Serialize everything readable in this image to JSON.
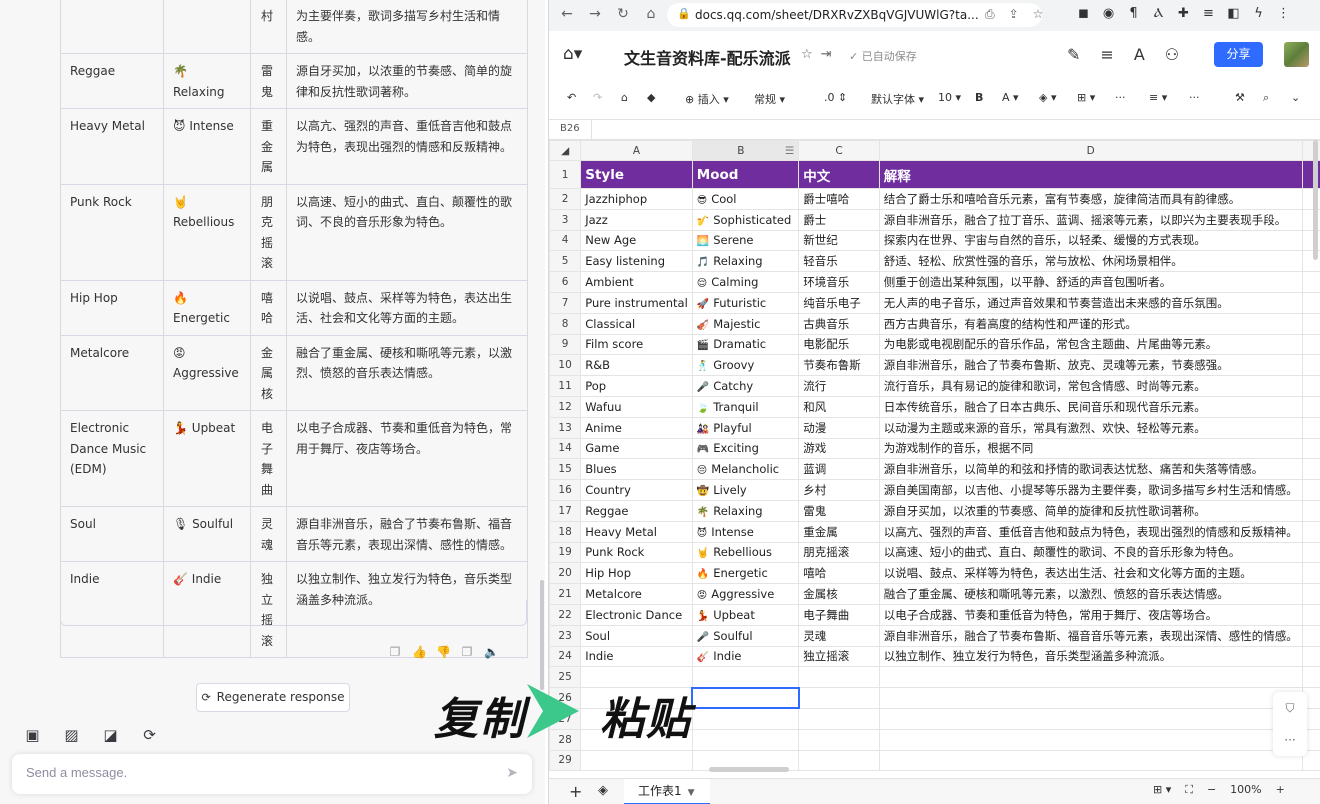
{
  "chat": {
    "rows": [
      {
        "style": "",
        "mood_emoji": "",
        "mood": "",
        "zh": "村",
        "desc": "为主要伴奏，歌词多描写乡村生活和情感。"
      },
      {
        "style": "Reggae",
        "mood_emoji": "🌴",
        "mood": "Relaxing",
        "zh": "雷鬼",
        "desc": "源自牙买加，以浓重的节奏感、简单的旋律和反抗性歌词著称。"
      },
      {
        "style": "Heavy Metal",
        "mood_emoji": "😈",
        "mood": "Intense",
        "zh": "重金属",
        "desc": "以高亢、强烈的声音、重低音吉他和鼓点为特色，表现出强烈的情感和反叛精神。"
      },
      {
        "style": "Punk Rock",
        "mood_emoji": "🤘",
        "mood": "Rebellious",
        "zh": "朋克摇滚",
        "desc": "以高速、短小的曲式、直白、颠覆性的歌词、不良的音乐形象为特色。"
      },
      {
        "style": "Hip Hop",
        "mood_emoji": "🔥",
        "mood": "Energetic",
        "zh": "嘻哈",
        "desc": "以说唱、鼓点、采样等为特色，表达出生活、社会和文化等方面的主题。"
      },
      {
        "style": "Metalcore",
        "mood_emoji": "😡",
        "mood": "Aggressive",
        "zh": "金属核",
        "desc": "融合了重金属、硬核和嘶吼等元素，以激烈、愤怒的音乐表达情感。"
      },
      {
        "style": "Electronic Dance Music (EDM)",
        "mood_emoji": "💃",
        "mood": "Upbeat",
        "zh": "电子舞曲",
        "desc": "以电子合成器、节奏和重低音为特色，常用于舞厅、夜店等场合。"
      },
      {
        "style": "Soul",
        "mood_emoji": "🎙",
        "mood": "Soulful",
        "zh": "灵魂",
        "desc": "源自非洲音乐，融合了节奏布鲁斯、福音音乐等元素，表现出深情、感性的情感。"
      },
      {
        "style": "Indie",
        "mood_emoji": "🎸",
        "mood": "Indie",
        "zh": "独立摇滚",
        "desc": "以独立制作、独立发行为特色，音乐类型涵盖多种流派。"
      }
    ],
    "regenerate_label": "Regenerate response",
    "input_placeholder": "Send a message."
  },
  "browser": {
    "url": "docs.qq.com/sheet/DRXRvZXBqVGJVUWlG?ta..."
  },
  "doc": {
    "title": "文生音资料库-配乐流派",
    "autosave": "已自动保存",
    "share_label": "分享"
  },
  "toolbar": {
    "insert": "插入",
    "format": "常规",
    "decimal": ".0",
    "font": "默认字体",
    "size": "10",
    "bold": "B",
    "more": "···"
  },
  "sheet": {
    "cell_ref": "B26",
    "col_letters": [
      "A",
      "B",
      "C",
      "D"
    ],
    "headers": [
      "Style",
      "Mood",
      "中文",
      "解释"
    ],
    "rows": [
      {
        "style": "Jazzhiphop",
        "emoji": "😎",
        "mood": "Cool",
        "zh": "爵士嘻哈",
        "desc": "结合了爵士乐和嘻哈音乐元素，富有节奏感，旋律简洁而具有韵律感。"
      },
      {
        "style": "Jazz",
        "emoji": "🎷",
        "mood": "Sophisticated",
        "zh": "爵士",
        "desc": "源自非洲音乐，融合了拉丁音乐、蓝调、摇滚等元素，以即兴为主要表现手段。"
      },
      {
        "style": "New Age",
        "emoji": "🌅",
        "mood": "Serene",
        "zh": "新世纪",
        "desc": "探索内在世界、宇宙与自然的音乐，以轻柔、缓慢的方式表现。"
      },
      {
        "style": "Easy listening",
        "emoji": "🎵",
        "mood": "Relaxing",
        "zh": "轻音乐",
        "desc": "舒适、轻松、欣赏性强的音乐，常与放松、休闲场景相伴。"
      },
      {
        "style": "Ambient",
        "emoji": "😌",
        "mood": "Calming",
        "zh": "环境音乐",
        "desc": "侧重于创造出某种氛围，以平静、舒适的声音包围听者。"
      },
      {
        "style": "Pure instrumental",
        "emoji": "🚀",
        "mood": "Futuristic",
        "zh": "纯音乐电子",
        "desc": "无人声的电子音乐，通过声音效果和节奏营造出未来感的音乐氛围。"
      },
      {
        "style": "Classical",
        "emoji": "🎻",
        "mood": "Majestic",
        "zh": "古典音乐",
        "desc": "西方古典音乐，有着高度的结构性和严谨的形式。"
      },
      {
        "style": "Film score",
        "emoji": "🎬",
        "mood": "Dramatic",
        "zh": "电影配乐",
        "desc": "为电影或电视剧配乐的音乐作品，常包含主题曲、片尾曲等元素。"
      },
      {
        "style": "R&B",
        "emoji": "🕺",
        "mood": "Groovy",
        "zh": "节奏布鲁斯",
        "desc": "源自非洲音乐，融合了节奏布鲁斯、放克、灵魂等元素，节奏感强。"
      },
      {
        "style": "Pop",
        "emoji": "🎤",
        "mood": "Catchy",
        "zh": "流行",
        "desc": "流行音乐，具有易记的旋律和歌词，常包含情感、时尚等元素。"
      },
      {
        "style": "Wafuu",
        "emoji": "🍃",
        "mood": "Tranquil",
        "zh": "和风",
        "desc": "日本传统音乐，融合了日本古典乐、民间音乐和现代音乐元素。"
      },
      {
        "style": "Anime",
        "emoji": "🎎",
        "mood": "Playful",
        "zh": "动漫",
        "desc": "以动漫为主题或来源的音乐，常具有激烈、欢快、轻松等元素。"
      },
      {
        "style": "Game",
        "emoji": "🎮",
        "mood": "Exciting",
        "zh": "游戏",
        "desc": "为游戏制作的音乐，根据不同"
      },
      {
        "style": "Blues",
        "emoji": "😔",
        "mood": "Melancholic",
        "zh": "蓝调",
        "desc": "源自非洲音乐，以简单的和弦和抒情的歌词表达忧愁、痛苦和失落等情感。"
      },
      {
        "style": "Country",
        "emoji": "🤠",
        "mood": "Lively",
        "zh": "乡村",
        "desc": "源自美国南部，以吉他、小提琴等乐器为主要伴奏，歌词多描写乡村生活和情感。"
      },
      {
        "style": "Reggae",
        "emoji": "🌴",
        "mood": "Relaxing",
        "zh": "雷鬼",
        "desc": "源自牙买加，以浓重的节奏感、简单的旋律和反抗性歌词著称。"
      },
      {
        "style": "Heavy Metal",
        "emoji": "😈",
        "mood": "Intense",
        "zh": "重金属",
        "desc": "以高亢、强烈的声音、重低音吉他和鼓点为特色，表现出强烈的情感和反叛精神。"
      },
      {
        "style": "Punk Rock",
        "emoji": "🤘",
        "mood": "Rebellious",
        "zh": "朋克摇滚",
        "desc": "以高速、短小的曲式、直白、颠覆性的歌词、不良的音乐形象为特色。"
      },
      {
        "style": "Hip Hop",
        "emoji": "🔥",
        "mood": "Energetic",
        "zh": "嘻哈",
        "desc": "以说唱、鼓点、采样等为特色，表达出生活、社会和文化等方面的主题。"
      },
      {
        "style": "Metalcore",
        "emoji": "😡",
        "mood": "Aggressive",
        "zh": "金属核",
        "desc": "融合了重金属、硬核和嘶吼等元素，以激烈、愤怒的音乐表达情感。"
      },
      {
        "style": "Electronic Dance",
        "emoji": "💃",
        "mood": "Upbeat",
        "zh": "电子舞曲",
        "desc": "以电子合成器、节奏和重低音为特色，常用于舞厅、夜店等场合。"
      },
      {
        "style": "Soul",
        "emoji": "🎤",
        "mood": "Soulful",
        "zh": "灵魂",
        "desc": "源自非洲音乐，融合了节奏布鲁斯、福音音乐等元素，表现出深情、感性的情感。"
      },
      {
        "style": "Indie",
        "emoji": "🎸",
        "mood": "Indie",
        "zh": "独立摇滚",
        "desc": "以独立制作、独立发行为特色，音乐类型涵盖多种流派。"
      }
    ],
    "empty_row_numbers": [
      "25",
      "26",
      "27",
      "28",
      "29"
    ],
    "tab_name": "工作表1",
    "zoom": "100%"
  },
  "annotation": {
    "copy": "复制",
    "paste": "粘贴"
  },
  "colors": {
    "header_bg": "#6f2d9e",
    "accent": "#2f6bff",
    "arrow": "#3cc88a"
  }
}
